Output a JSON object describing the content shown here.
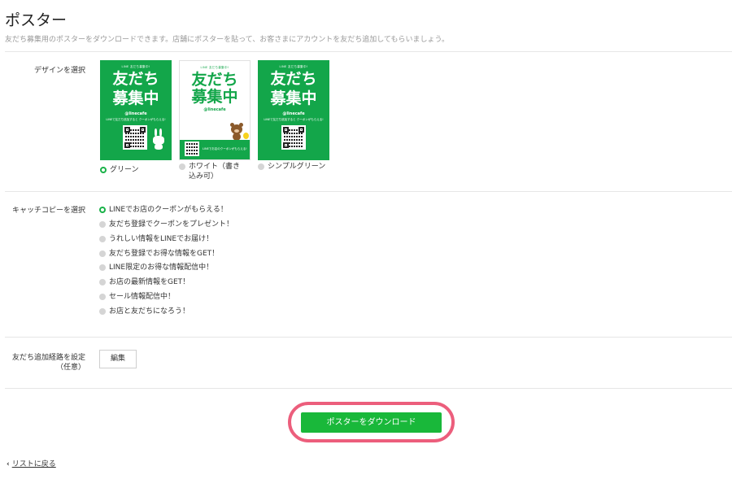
{
  "header": {
    "title": "ポスター",
    "subtitle": "友だち募集用のポスターをダウンロードできます。店舗にポスターを貼って、お客さまにアカウントを友だち追加してもらいましょう。"
  },
  "design": {
    "label": "デザインを選択",
    "posters": [
      {
        "top": "LINE 友だち募集中!",
        "headline_line1": "友だち",
        "headline_line2": "募集中",
        "handle": "@linecafe",
        "small": "LINEで友だち追加すると クーポンがもらえる!"
      },
      {
        "top": "LINE 友だち募集中!",
        "headline_line1": "友だち",
        "headline_line2": "募集中",
        "handle": "@linecafe",
        "small": "LINEでお店のクーポンがもらえる!"
      },
      {
        "top": "LINE 友だち募集中!",
        "headline_line1": "友だち",
        "headline_line2": "募集中",
        "handle": "@linecafe",
        "small": "LINEで友だち追加すると クーポンがもらえる!"
      }
    ],
    "options": [
      {
        "label": "グリーン",
        "selected": true
      },
      {
        "label": "ホワイト（書き込み可）",
        "selected": false
      },
      {
        "label": "シンプルグリーン",
        "selected": false
      }
    ]
  },
  "catchcopy": {
    "label": "キャッチコピーを選択",
    "options": [
      {
        "label": "LINEでお店のクーポンがもらえる！",
        "selected": true
      },
      {
        "label": "友だち登録でクーポンをプレゼント！",
        "selected": false
      },
      {
        "label": "うれしい情報をLINEでお届け！",
        "selected": false
      },
      {
        "label": "友だち登録でお得な情報をGET！",
        "selected": false
      },
      {
        "label": "LINE限定のお得な情報配信中！",
        "selected": false
      },
      {
        "label": "お店の最新情報をGET！",
        "selected": false
      },
      {
        "label": "セール情報配信中！",
        "selected": false
      },
      {
        "label": "お店と友だちになろう！",
        "selected": false
      }
    ]
  },
  "route": {
    "label_line1": "友だち追加経路を設定",
    "label_line2": "（任意）",
    "edit_label": "編集"
  },
  "download_label": "ポスターをダウンロード",
  "back_label": "リストに戻る",
  "colors": {
    "green": "#13a64a",
    "button": "#19b83a",
    "highlight": "#ec5e7c"
  }
}
